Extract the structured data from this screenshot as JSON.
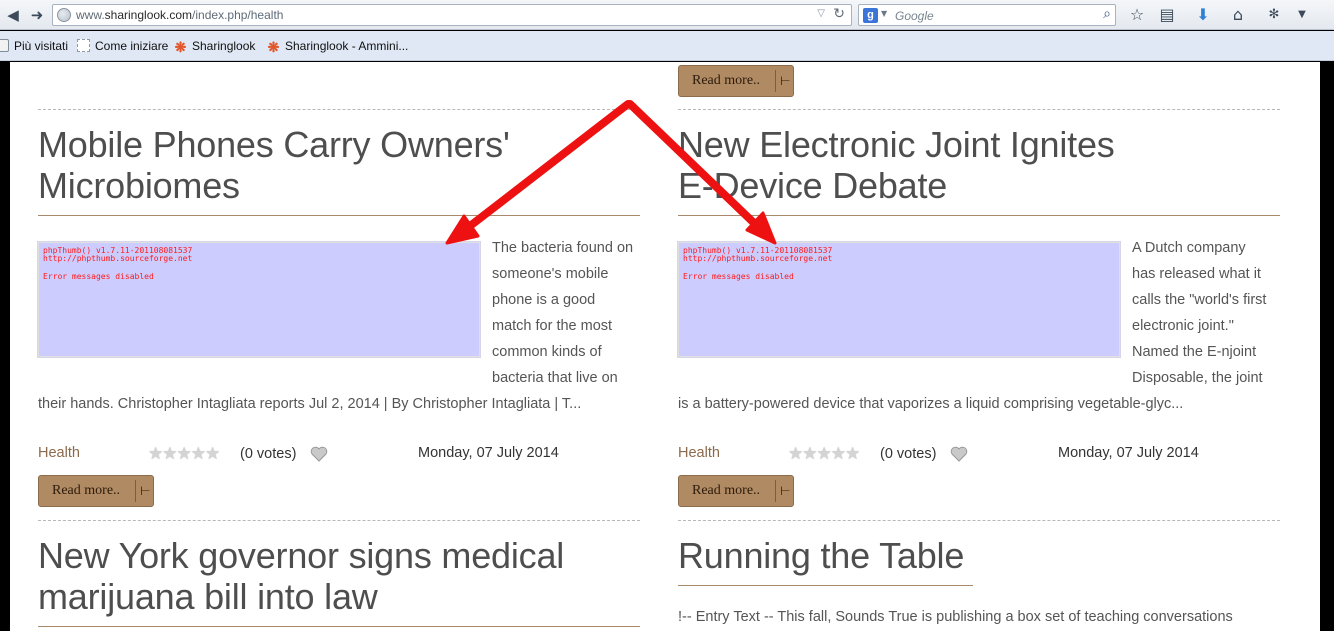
{
  "browser": {
    "url_prefix": "www.",
    "url_domain": "sharinglook.com",
    "url_path": "/index.php/health",
    "search_engine_letter": "g",
    "search_placeholder": "Google",
    "bookmarks": [
      "Più visitati",
      "Come iniziare",
      "Sharinglook",
      "Sharinglook - Ammini..."
    ]
  },
  "top_readmore_label": "Read more..",
  "articles": [
    {
      "title_lines": [
        "Mobile Phones Carry Owners'",
        "Microbiomes"
      ],
      "thumb_lines": [
        "phpThumb() v1.7.11-201108081537",
        "http://phpthumb.sourceforge.net",
        "Error messages disabled"
      ],
      "side_lines": [
        "The bacteria found on",
        "someone's mobile",
        "phone is a good",
        "match for the most",
        "common kinds of",
        "bacteria that live on"
      ],
      "full_line": "their hands. Christopher Intagliata reports Jul 2, 2014 | By Christopher Intagliata | T...",
      "category": "Health",
      "votes": "(0 votes)",
      "date": "Monday, 07 July 2014",
      "readmore": "Read more.."
    },
    {
      "title_lines": [
        "New Electronic Joint Ignites",
        "E-Device Debate"
      ],
      "thumb_lines": [
        "phpThumb() v1.7.11-201108081537",
        "http://phpthumb.sourceforge.net",
        "Error messages disabled"
      ],
      "side_lines": [
        "A Dutch company",
        "has released what it",
        "calls the \"world's first",
        "electronic joint.\"",
        "Named the E-njoint",
        "Disposable, the joint"
      ],
      "full_line": "is a battery-powered device that vaporizes a liquid comprising vegetable-glyc...",
      "category": "Health",
      "votes": "(0 votes)",
      "date": "Monday, 07 July 2014",
      "readmore": "Read more.."
    },
    {
      "title_lines": [
        "New York governor signs medical",
        "marijuana bill into law"
      ]
    },
    {
      "title_lines": [
        "Running the Table"
      ],
      "intro_line": "!-- Entry Text -- This fall, Sounds True is publishing a box set of teaching conversations"
    }
  ],
  "colors": {
    "accent_brown": "#b08a63",
    "thumb_bg": "#ccccff",
    "thumb_text": "#ff1a1a",
    "annotation_arrow": "#ee1111"
  }
}
